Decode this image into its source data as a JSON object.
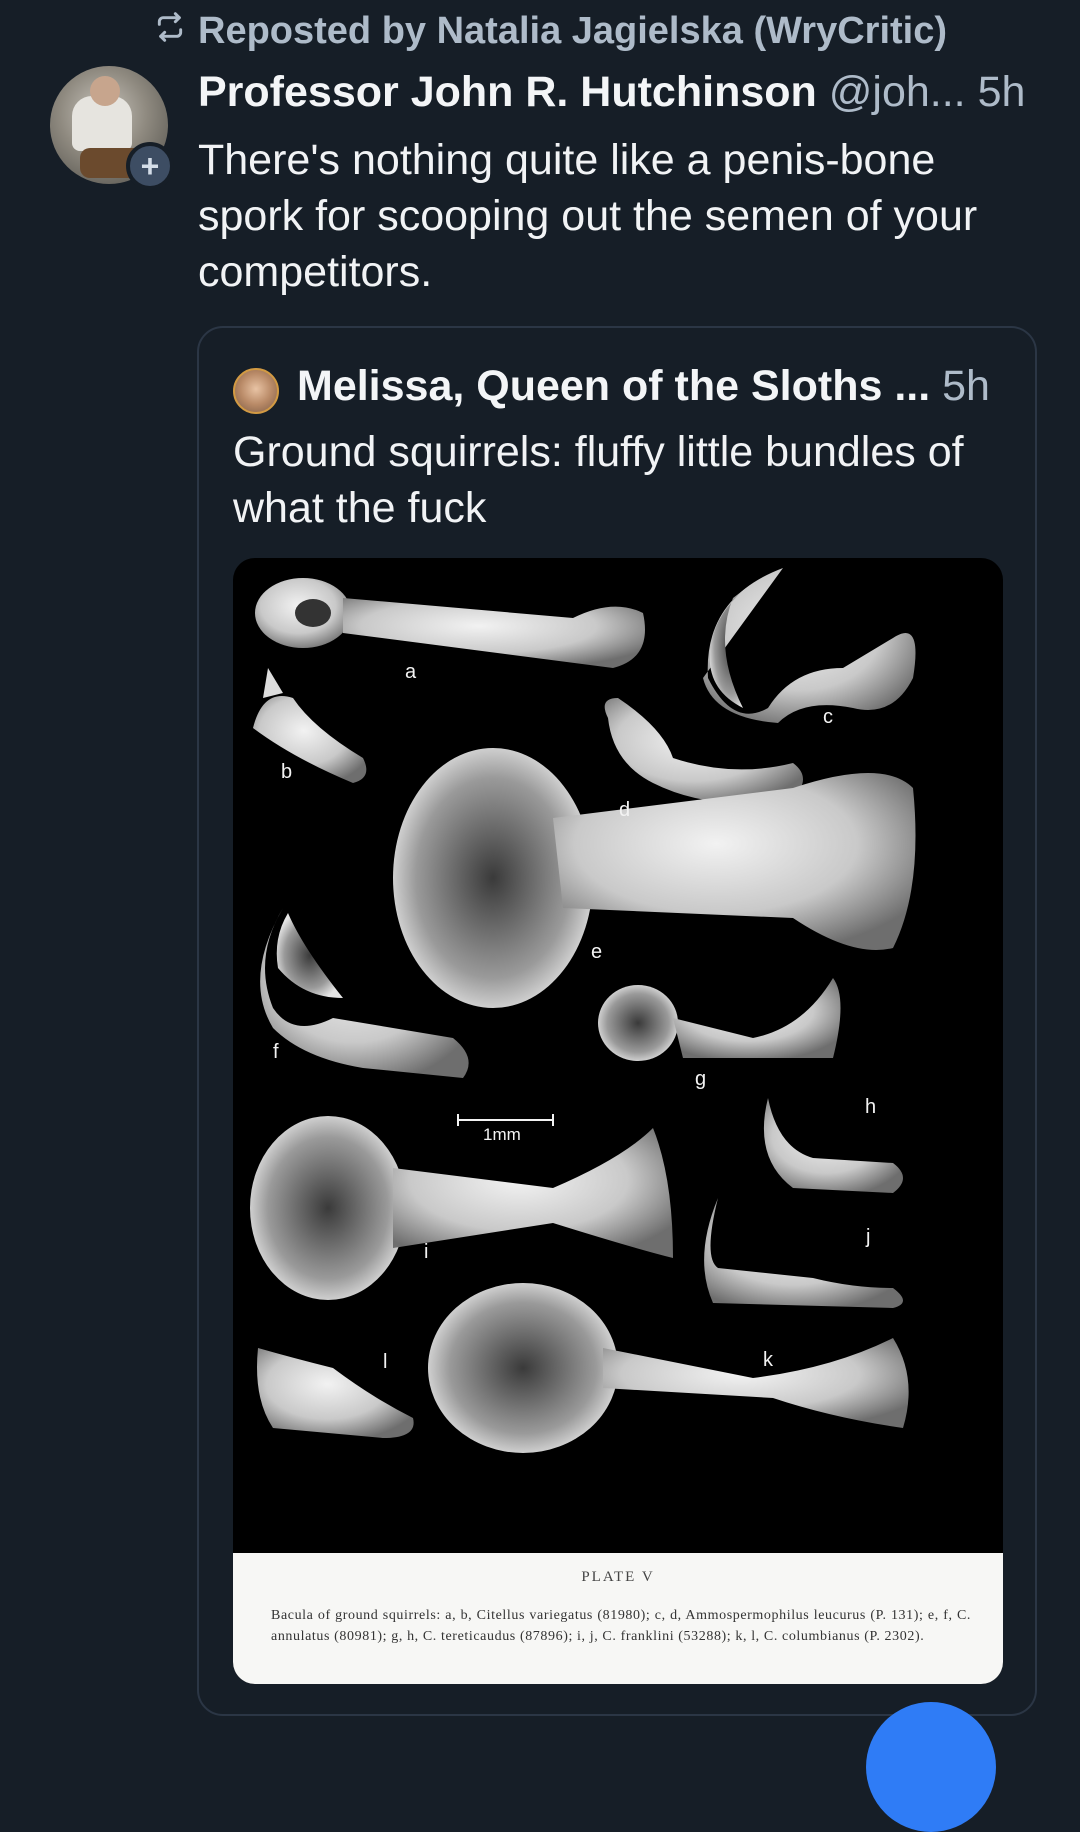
{
  "repost": {
    "icon": "repost-icon",
    "text": "Reposted by Natalia Jagielska (WryCritic)"
  },
  "post": {
    "author_name": "Professor John R. Hutchinson",
    "handle": "@joh...",
    "time": "5h",
    "follow_icon": "plus-icon",
    "follow_symbol": "+",
    "text": "There's nothing quite like a penis-bone spork for scooping out the semen of your competitors."
  },
  "quote": {
    "author_name": "Melissa, Queen of the Sloths ...",
    "time": "5h",
    "text": "Ground squirrels: fluffy little bundles of what the fuck",
    "image": {
      "labels": [
        "a",
        "b",
        "c",
        "d",
        "e",
        "f",
        "g",
        "h",
        "i",
        "j",
        "k",
        "l"
      ],
      "scale_label": "1mm",
      "plate_title": "PLATE V",
      "caption": "Bacula of ground squirrels: a, b, Citellus variegatus (81980); c, d, Ammospermophilus leucurus (P. 131); e, f, C. annulatus (80981); g, h, C. tereticaudus (87896); i, j, C. franklini (53288); k, l, C. columbianus (P. 2302)."
    }
  },
  "colors": {
    "background": "#161e27",
    "muted": "#aebbc9",
    "card_border": "#2b3645",
    "fab": "#2f7cf6"
  }
}
